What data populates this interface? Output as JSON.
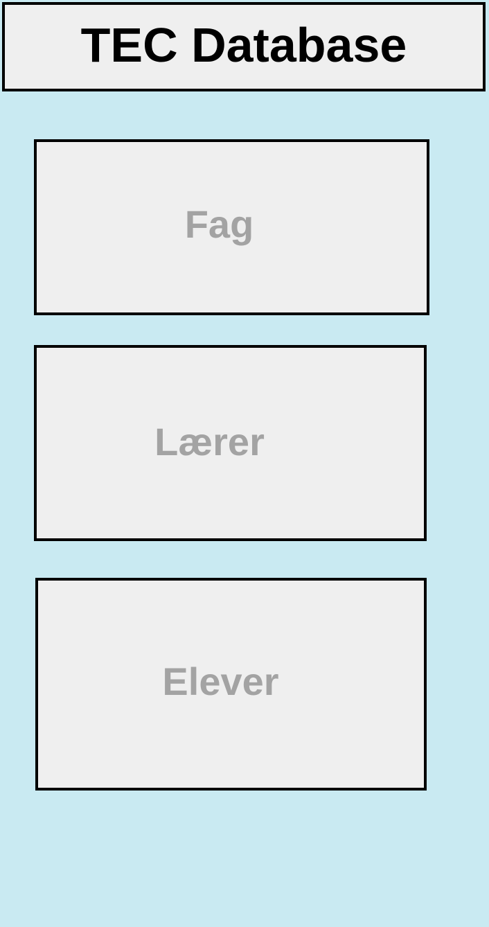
{
  "header": {
    "title": "TEC Database"
  },
  "menu": {
    "items": [
      {
        "label": "Fag"
      },
      {
        "label": "Lærer"
      },
      {
        "label": "Elever"
      }
    ]
  },
  "colors": {
    "background": "#c9eaf2",
    "panel": "#efefef",
    "border": "#000000",
    "label": "#a3a3a3"
  }
}
